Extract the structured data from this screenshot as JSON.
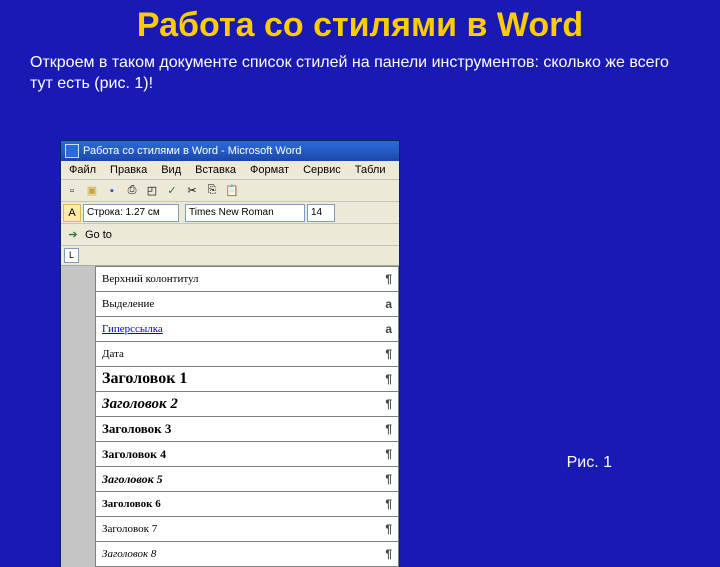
{
  "slide": {
    "title": "Работа со стилями в Word",
    "subtitle": "Откроем в таком документе список стилей на панели инструментов: сколько же всего тут есть (рис. 1)!",
    "caption": "Рис. 1"
  },
  "word": {
    "title": "Работа со стилями в Word - Microsoft Word",
    "menu": [
      "Файл",
      "Правка",
      "Вид",
      "Вставка",
      "Формат",
      "Сервис",
      "Табли"
    ],
    "style_field": "Строка: 1.27 см",
    "font_field": "Times New Roman",
    "size_field": "14",
    "goto_label": "Go to",
    "ruler_mark": "L"
  },
  "styles": [
    {
      "label": "Верхний колонтитул",
      "cls": "",
      "mark": "¶"
    },
    {
      "label": "Выделение",
      "cls": "",
      "mark": "a"
    },
    {
      "label": "Гиперссылка",
      "cls": "hyperlink",
      "mark": "a"
    },
    {
      "label": "Дата",
      "cls": "",
      "mark": "¶"
    },
    {
      "label": "Заголовок 1",
      "cls": "h1",
      "mark": "¶"
    },
    {
      "label": "Заголовок 2",
      "cls": "h2",
      "mark": "¶"
    },
    {
      "label": "Заголовок 3",
      "cls": "h3",
      "mark": "¶"
    },
    {
      "label": "Заголовок 4",
      "cls": "h4",
      "mark": "¶"
    },
    {
      "label": "Заголовок 5",
      "cls": "h5",
      "mark": "¶"
    },
    {
      "label": "Заголовок 6",
      "cls": "h6",
      "mark": "¶"
    },
    {
      "label": "Заголовок 7",
      "cls": "h7",
      "mark": "¶"
    },
    {
      "label": "Заголовок 8",
      "cls": "h8",
      "mark": "¶"
    }
  ]
}
